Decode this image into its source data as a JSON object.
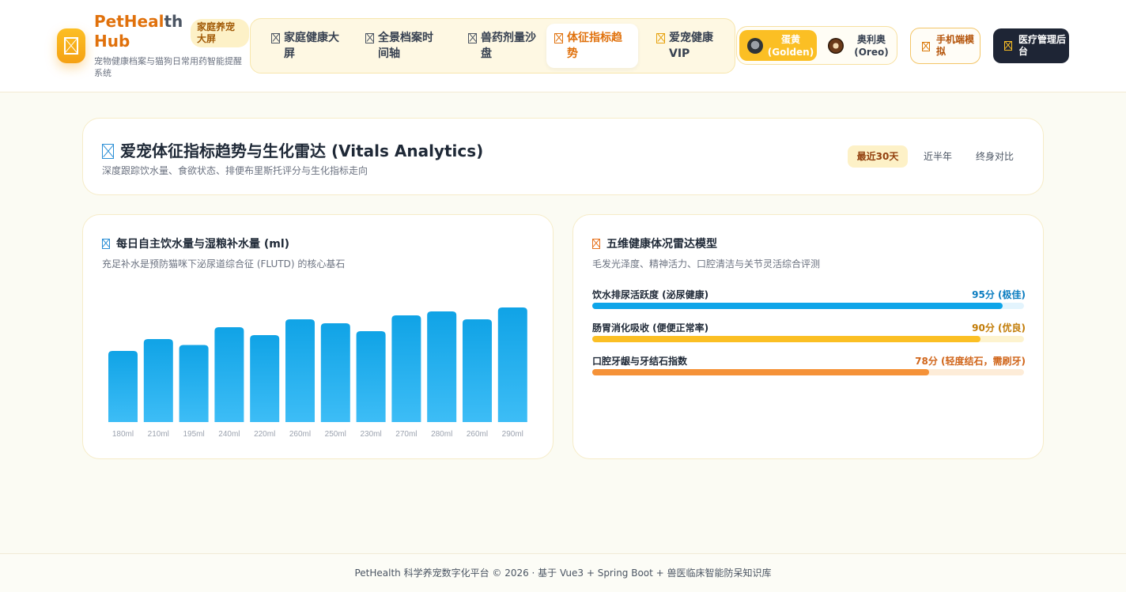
{
  "header": {
    "brand_part1": "PetHeal",
    "brand_part2": "th",
    "brand_line2": "Hub",
    "badge": "家庭养宠大屏",
    "subtitle": "宠物健康档案与猫狗日常用药智能提醒系统",
    "nav": [
      {
        "label": "家庭健康大屏",
        "active": false
      },
      {
        "label": "全景档案时间轴",
        "active": false
      },
      {
        "label": "兽药剂量沙盘",
        "active": false
      },
      {
        "label": "体征指标趋势",
        "active": true
      },
      {
        "label": "爱宠健康VIP",
        "active": false
      }
    ],
    "pets": [
      {
        "name": "蛋黄 (Golden)",
        "active": true
      },
      {
        "name": "奥利奥 (Oreo)",
        "active": false
      }
    ],
    "mobile_button": "手机端模拟",
    "admin_button": "医疗管理后台"
  },
  "page": {
    "title": "爱宠体征指标趋势与生化雷达 (Vitals Analytics)",
    "subtitle": "深度跟踪饮水量、食欲状态、排便布里斯托评分与生化指标走向",
    "ranges": [
      {
        "label": "最近30天",
        "active": true
      },
      {
        "label": "近半年",
        "active": false
      },
      {
        "label": "终身对比",
        "active": false
      }
    ]
  },
  "water": {
    "title": "每日自主饮水量与湿粮补水量 (ml)",
    "subtitle": "充足补水是预防猫咪下泌尿道综合征 (FLUTD) 的核心基石"
  },
  "chart_data": {
    "type": "bar",
    "values": [
      180,
      210,
      195,
      240,
      220,
      260,
      250,
      230,
      270,
      280,
      260,
      290
    ],
    "data_labels": [
      "180ml",
      "210ml",
      "195ml",
      "240ml",
      "220ml",
      "260ml",
      "250ml",
      "230ml",
      "270ml",
      "280ml",
      "260ml",
      "290ml"
    ],
    "ylim": [
      0,
      300
    ],
    "grid": false,
    "colors": {
      "top": "#10a3e6",
      "bottom": "#3dbdf6"
    }
  },
  "radar": {
    "title": "五维健康体况雷达模型",
    "subtitle": "毛发光泽度、精神活力、口腔清洁与关节灵活综合评测",
    "metrics": [
      {
        "label": "饮水排尿活跃度 (泌尿健康)",
        "value_text": "95分 (极佳)",
        "score": 95,
        "color": "#0ea5e9",
        "track": "#e3f4fd",
        "text_color": "#0b7dc0"
      },
      {
        "label": "肠胃消化吸收 (便便正常率)",
        "value_text": "90分 (优良)",
        "score": 90,
        "color": "#fbbf24",
        "track": "#fdf3cf",
        "text_color": "#c27c07"
      },
      {
        "label": "口腔牙龈与牙结石指数",
        "value_text": "78分 (轻度结石，需刷牙)",
        "score": 78,
        "color": "#f59238",
        "track": "#fdecd8",
        "text_color": "#d0651a"
      }
    ]
  },
  "footer": {
    "text": "PetHealth 科学养宠数字化平台 © 2026 · 基于 Vue3 + Spring Boot + 兽医临床智能防呆知识库"
  }
}
